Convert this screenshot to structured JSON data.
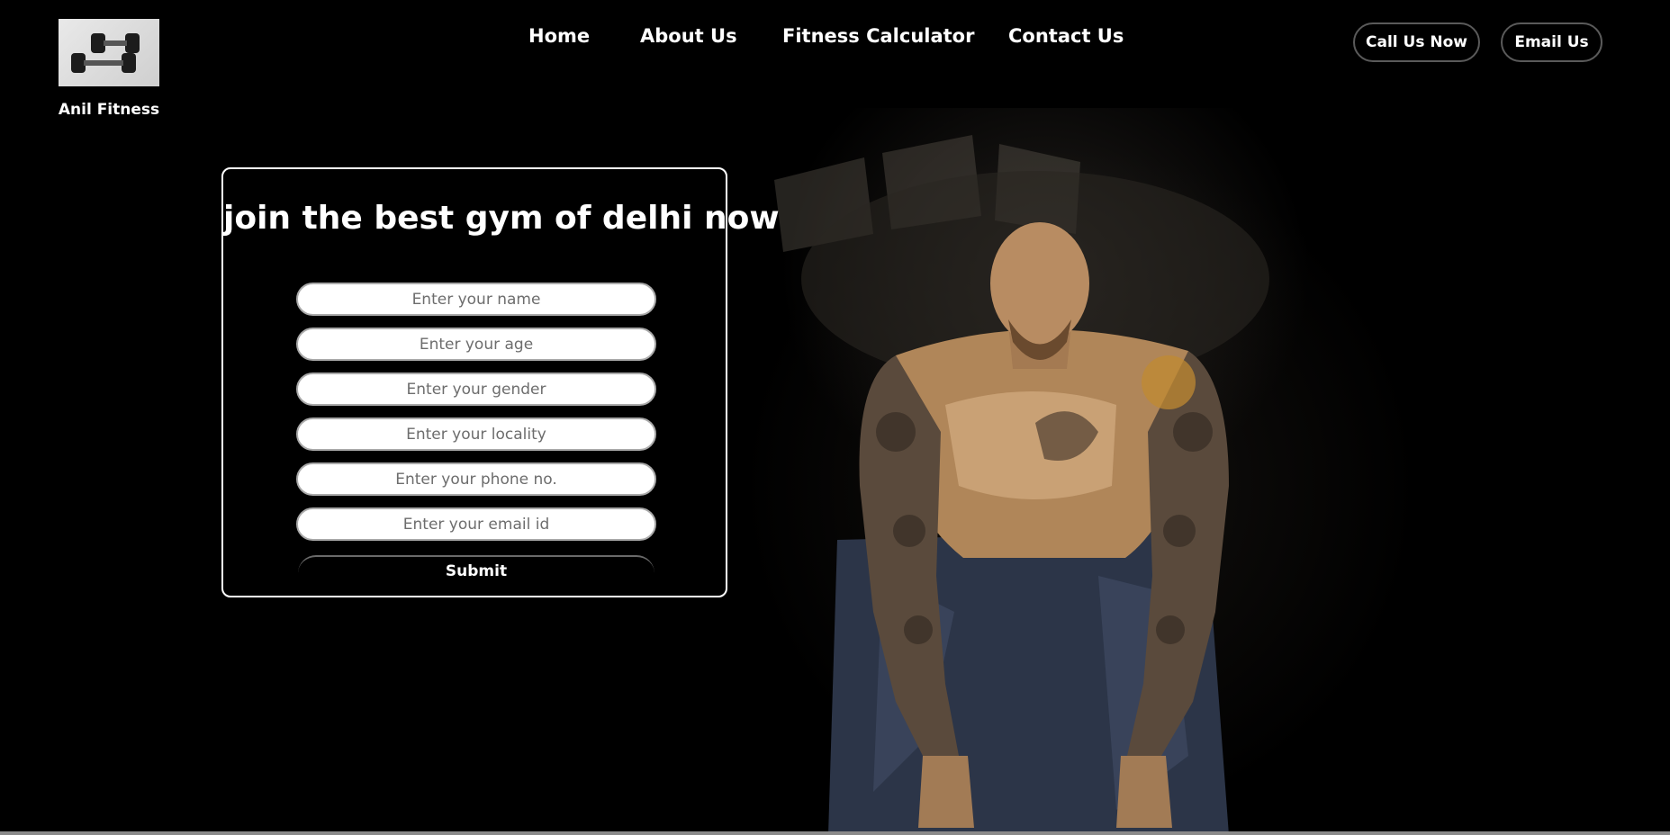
{
  "brand": {
    "name": "Anil Fitness",
    "logo_icon": "dumbbell-icon"
  },
  "nav": {
    "items": [
      {
        "label": "Home"
      },
      {
        "label": "About Us"
      },
      {
        "label": "Fitness Calculator"
      },
      {
        "label": "Contact Us"
      }
    ]
  },
  "actions": {
    "call_label": "Call Us Now",
    "email_label": "Email Us"
  },
  "form": {
    "title": "join the best gym of delhi now",
    "fields": [
      {
        "placeholder": "Enter your name",
        "value": ""
      },
      {
        "placeholder": "Enter your age",
        "value": ""
      },
      {
        "placeholder": "Enter your gender",
        "value": ""
      },
      {
        "placeholder": "Enter your locality",
        "value": ""
      },
      {
        "placeholder": "Enter your phone no.",
        "value": ""
      },
      {
        "placeholder": "Enter your email id",
        "value": ""
      }
    ],
    "submit_label": "Submit"
  },
  "colors": {
    "background": "#000000",
    "text": "#ffffff",
    "field_background": "#ffffff",
    "field_border": "#a9a9a9",
    "pill_border": "#5a5a5a"
  }
}
